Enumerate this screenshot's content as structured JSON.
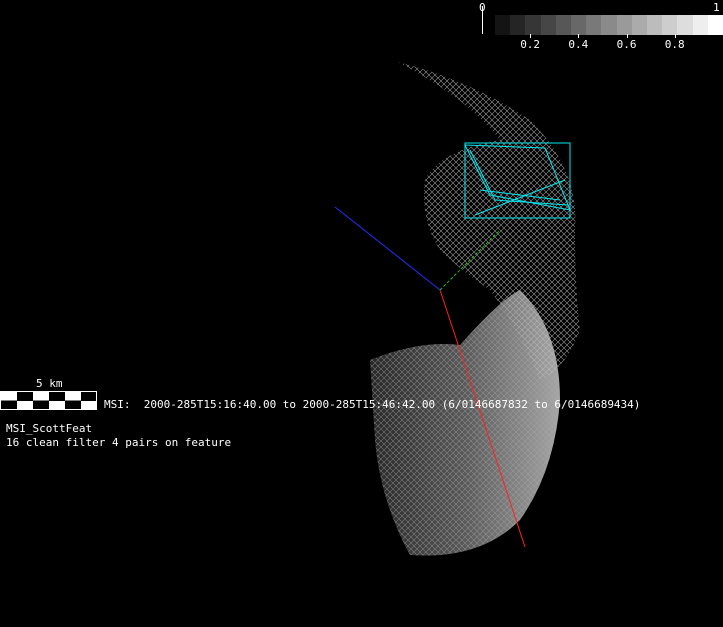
{
  "colorbar": {
    "min_label": "0",
    "max_label": "1",
    "tick_labels": [
      "0.2",
      "0.4",
      "0.6",
      "0.8"
    ],
    "tick_values": [
      0.2,
      0.4,
      0.6,
      0.8
    ],
    "steps": 15
  },
  "scale_bar": {
    "label": "5 km"
  },
  "info": {
    "msi_line": "MSI:  2000-285T15:16:40.00 to 2000-285T15:46:42.00 (6/0146687832 to 6/0146689434)",
    "feature_name": "MSI_ScottFeat",
    "feature_desc": "16 clean filter 4 pairs on feature"
  },
  "colors": {
    "axis_x": "#ff2020",
    "axis_y": "#20c020",
    "axis_z": "#2030ff",
    "footprint": "#00e8f0"
  }
}
